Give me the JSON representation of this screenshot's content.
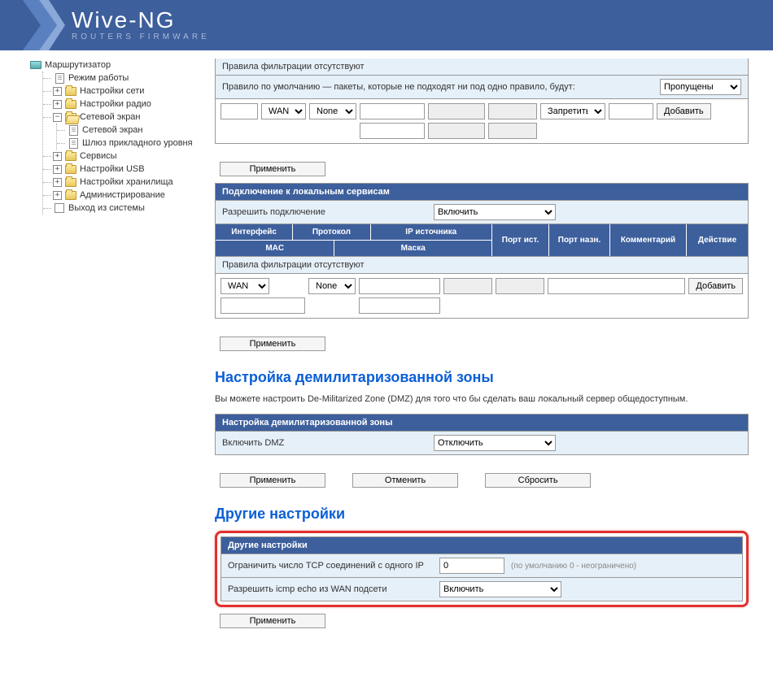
{
  "brand": {
    "title": "Wive-NG",
    "subtitle": "ROUTERS FIRMWARE"
  },
  "sidebar": {
    "router": "Маршрутизатор",
    "mode": "Режим работы",
    "net": "Настройки сети",
    "radio": "Настройки радио",
    "firewall": "Сетевой экран",
    "firewall_sub": "Сетевой экран",
    "alg": "Шлюз прикладного уровня",
    "services": "Сервисы",
    "usb": "Настройки USB",
    "storage": "Настройки хранилища",
    "admin": "Администрирование",
    "logout": "Выход из системы"
  },
  "filter": {
    "empty": "Правила фильтрации отсутствуют",
    "default_rule_label": "Правило по умолчанию — пакеты, которые не подходят ни под одно правило, будут:",
    "default_action": "Пропущены",
    "iface": "WAN",
    "proto": "None",
    "deny": "Запретить",
    "add": "Добавить",
    "apply": "Применить"
  },
  "local": {
    "head": "Подключение к локальным сервисам",
    "allow_label": "Разрешить подключение",
    "allow_value": "Включить",
    "th_iface": "Интерфейс",
    "th_proto": "Протокол",
    "th_srcip": "IP источника",
    "th_mac": "MAC",
    "th_mask": "Маска",
    "th_sport": "Порт ист.",
    "th_dport": "Порт назн.",
    "th_comment": "Комментарий",
    "th_action": "Действие",
    "empty": "Правила фильтрации отсутствуют",
    "iface": "WAN",
    "proto": "None",
    "add": "Добавить",
    "apply": "Применить"
  },
  "dmz": {
    "title": "Настройка демилитаризованной зоны",
    "desc": "Вы можете настроить De-Militarized Zone (DMZ) для того что бы сделать ваш локальный сервер общедоступным.",
    "head": "Настройка демилитаризованной зоны",
    "enable_label": "Включить DMZ",
    "enable_value": "Отключить",
    "apply": "Применить",
    "cancel": "Отменить",
    "reset": "Сбросить"
  },
  "other": {
    "title": "Другие настройки",
    "head": "Другие настройки",
    "tcp_label": "Ограничить число TCP соединений с одного IP",
    "tcp_value": "0",
    "tcp_hint": "(по умолчанию 0 - неограничено)",
    "icmp_label": "Разрешить icmp echo из WAN подсети",
    "icmp_value": "Включить",
    "apply": "Применить"
  }
}
